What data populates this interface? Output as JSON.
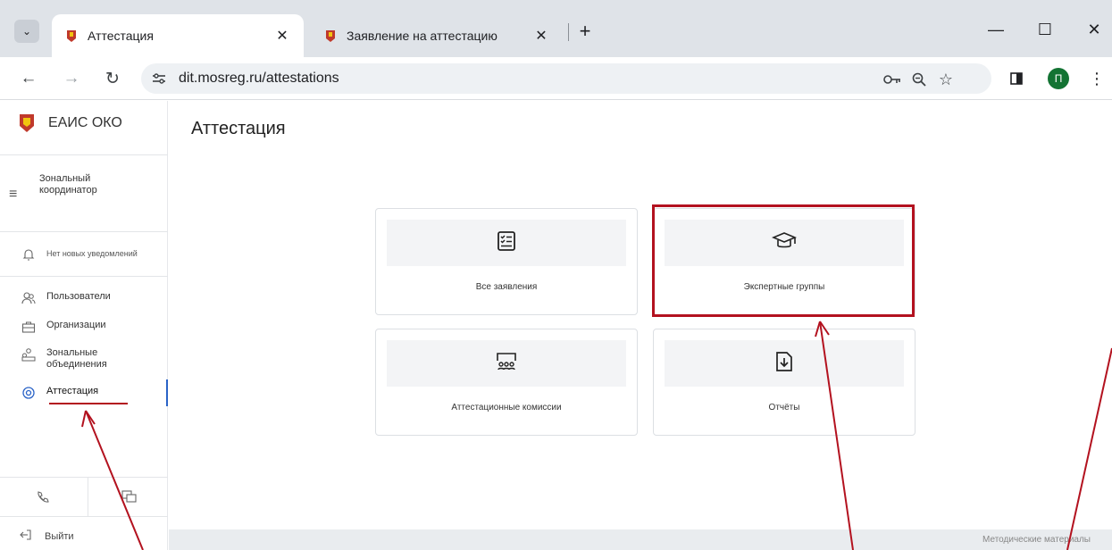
{
  "browser": {
    "tabs": [
      {
        "title": "Аттестация",
        "active": true
      },
      {
        "title": "Заявление на аттестацию",
        "active": false
      }
    ],
    "url": "dit.mosreg.ru/attestations",
    "profile_initial": "П",
    "icons": [
      "tab-search-icon",
      "new-tab-icon",
      "minimize-icon",
      "maximize-icon",
      "close-window-icon",
      "back-icon",
      "forward-icon",
      "reload-icon",
      "site-settings-icon",
      "password-key-icon",
      "zoom-icon",
      "bookmark-star-icon",
      "side-panel-icon",
      "menu-dots-icon"
    ]
  },
  "sidebar": {
    "brand": "ЕАИС ОКО",
    "role": "Зональный координатор",
    "notifications": "Нет новых уведомлений",
    "items": [
      {
        "label": "Пользователи",
        "icon": "users-icon"
      },
      {
        "label": "Организации",
        "icon": "briefcase-icon"
      },
      {
        "label": "Зональные объединения",
        "icon": "groups-icon"
      },
      {
        "label": "Аттестация",
        "icon": "attestation-icon",
        "active": true
      }
    ],
    "logout": "Выйти"
  },
  "main": {
    "title": "Аттестация",
    "cards": [
      {
        "label": "Все заявления",
        "icon": "checklist-icon"
      },
      {
        "label": "Экспертные группы",
        "icon": "graduation-cap-icon",
        "highlighted": true
      },
      {
        "label": "Аттестационные комиссии",
        "icon": "commission-icon"
      },
      {
        "label": "Отчёты",
        "icon": "download-document-icon"
      }
    ]
  },
  "footer": {
    "link": "Методические материалы"
  },
  "colors": {
    "annotation": "#b3121f",
    "active_accent": "#2a63c7",
    "tabstrip": "#dfe3e8",
    "profile": "#137333"
  }
}
